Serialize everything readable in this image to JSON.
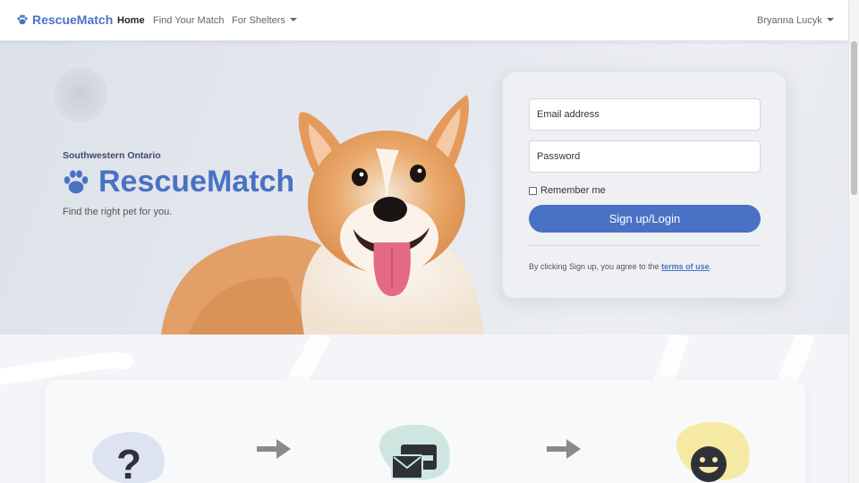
{
  "nav": {
    "brand": "RescueMatch",
    "links": [
      {
        "label": "Home",
        "active": true
      },
      {
        "label": "Find Your Match",
        "active": false
      },
      {
        "label": "For Shelters",
        "dropdown": true
      }
    ],
    "user": "Bryanna Lucyk"
  },
  "hero": {
    "region": "Southwestern Ontario",
    "title": "RescueMatch",
    "tagline": "Find the right pet for you."
  },
  "login": {
    "email_placeholder": "Email address",
    "password_placeholder": "Password",
    "remember_label": "Remember me",
    "submit_label": "Sign up/Login",
    "terms_prefix": "By clicking Sign up, you agree to the",
    "terms_link": "terms of use",
    "terms_suffix": "."
  },
  "steps": [
    {
      "icon": "question-icon",
      "blob_color": "#dde3f0"
    },
    {
      "icon": "envelopes-icon",
      "blob_color": "#cfe6e0"
    },
    {
      "icon": "smile-icon",
      "blob_color": "#f6e9a4"
    }
  ],
  "colors": {
    "brand": "#4a72c4",
    "navy": "#3f4a6a"
  }
}
